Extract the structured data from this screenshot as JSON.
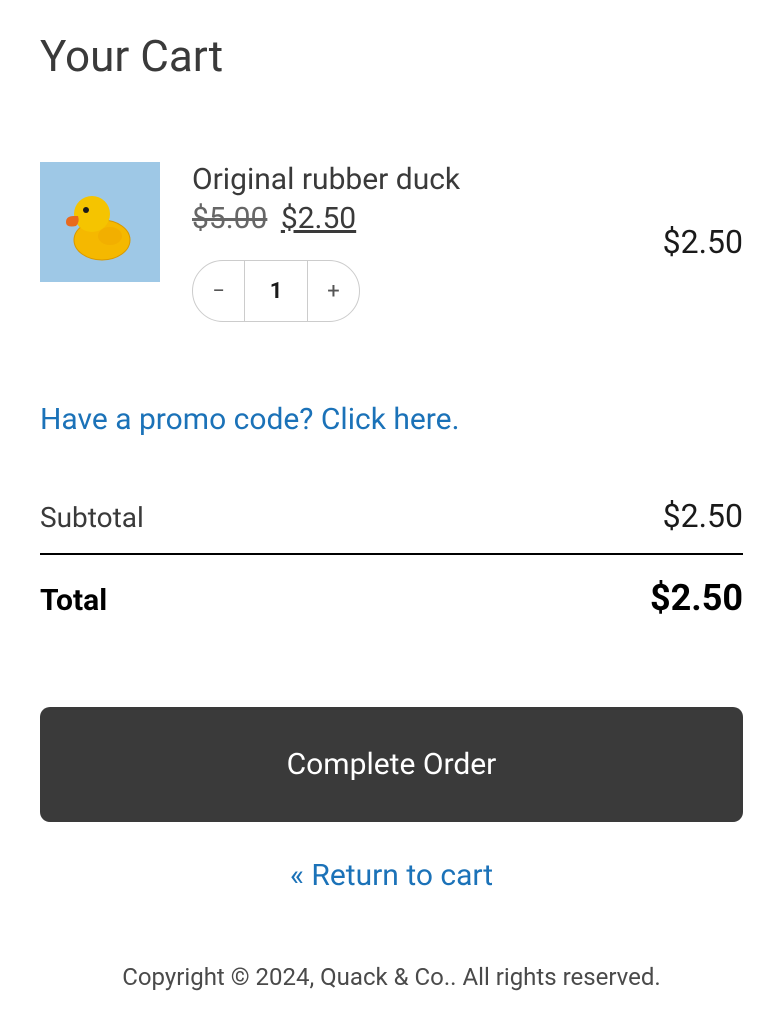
{
  "page_title": "Your Cart",
  "item": {
    "name": "Original rubber duck",
    "original_price": "$5.00",
    "sale_price": "$2.50",
    "quantity": "1",
    "line_total": "$2.50"
  },
  "promo_text": "Have a promo code? Click here.",
  "subtotal": {
    "label": "Subtotal",
    "value": "$2.50"
  },
  "total": {
    "label": "Total",
    "value": "$2.50"
  },
  "complete_order_label": "Complete Order",
  "return_link_text": "« Return to cart",
  "footer_text": "Copyright © 2024, Quack & Co.. All rights reserved."
}
